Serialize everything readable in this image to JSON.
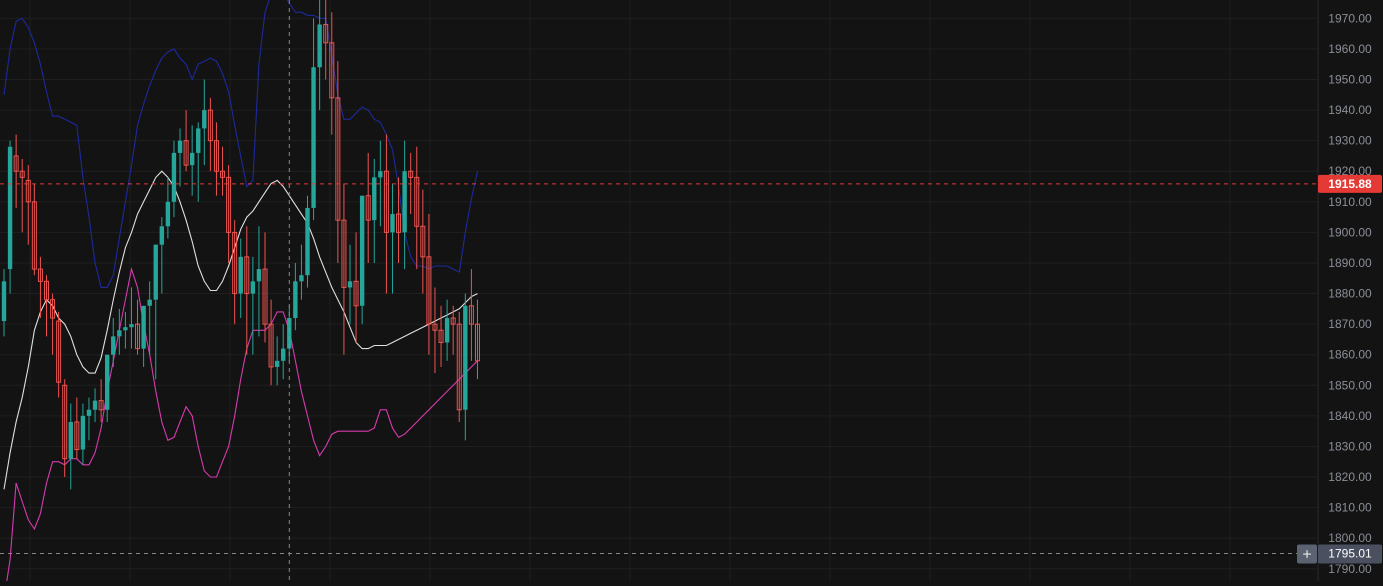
{
  "chart_data": {
    "type": "candlestick",
    "title": "",
    "xlabel": "",
    "ylabel": "",
    "ylim": [
      1786,
      1976
    ],
    "y_ticks": [
      "1970.00",
      "1960.00",
      "1950.00",
      "1940.00",
      "1930.00",
      "1920.00",
      "1910.00",
      "1900.00",
      "1890.00",
      "1880.00",
      "1870.00",
      "1860.00",
      "1850.00",
      "1840.00",
      "1830.00",
      "1820.00",
      "1810.00",
      "1800.00",
      "1790.00"
    ],
    "grid": true,
    "price_tag": {
      "value": "1915.88",
      "color": "#e53935"
    },
    "crosshair_tag": {
      "value": "1795.01",
      "color": "#4a5060"
    },
    "overlays": [
      {
        "name": "",
        "color": "#1c2a9c",
        "values": [
          1945,
          1960,
          1969,
          1970,
          1967,
          1962,
          1955,
          1946,
          1938,
          1938,
          1937,
          1936,
          1935,
          1918,
          1905,
          1890,
          1882,
          1882,
          1886,
          1898,
          1910,
          1922,
          1935,
          1942,
          1948,
          1953,
          1957,
          1959,
          1960,
          1957,
          1955,
          1950,
          1955,
          1956,
          1957,
          1956,
          1952,
          1946,
          1935,
          1925,
          1915,
          1917,
          1955,
          1972,
          1978,
          1978,
          1978,
          1975,
          1972,
          1972,
          1971,
          1971,
          1970,
          1970,
          1958,
          1945,
          1937,
          1937,
          1939,
          1941,
          1940,
          1937,
          1936,
          1932,
          1927,
          1915,
          1900,
          1892,
          1889,
          1889,
          1888,
          1889,
          1889,
          1889,
          1888,
          1887,
          1900,
          1911,
          1920
        ]
      },
      {
        "name": "",
        "color": "#e0e0e0",
        "values": [
          1816,
          1828,
          1838,
          1846,
          1856,
          1868,
          1874,
          1878,
          1876,
          1872,
          1870,
          1866,
          1860,
          1856,
          1854,
          1854,
          1859,
          1868,
          1878,
          1887,
          1895,
          1900,
          1906,
          1910,
          1914,
          1918,
          1920,
          1918,
          1915,
          1910,
          1904,
          1897,
          1889,
          1884,
          1881,
          1881,
          1884,
          1889,
          1895,
          1901,
          1905,
          1907,
          1910,
          1913,
          1916,
          1917,
          1915,
          1912,
          1909,
          1906,
          1903,
          1898,
          1892,
          1887,
          1882,
          1878,
          1874,
          1869,
          1864,
          1862,
          1862,
          1863,
          1863,
          1863,
          1864,
          1865,
          1866,
          1867,
          1868,
          1869,
          1870,
          1871,
          1872,
          1873,
          1874,
          1875,
          1877,
          1879,
          1880
        ]
      },
      {
        "name": "",
        "color": "#d63aaf",
        "values": [
          1780,
          1793,
          1818,
          1812,
          1806,
          1803,
          1808,
          1818,
          1825,
          1825,
          1824,
          1826,
          1826,
          1824,
          1824,
          1828,
          1836,
          1848,
          1858,
          1868,
          1878,
          1888,
          1882,
          1870,
          1860,
          1848,
          1838,
          1832,
          1833,
          1838,
          1843,
          1840,
          1830,
          1822,
          1820,
          1820,
          1825,
          1830,
          1840,
          1852,
          1862,
          1868,
          1868,
          1868,
          1870,
          1874,
          1874,
          1868,
          1858,
          1848,
          1840,
          1832,
          1827,
          1830,
          1834,
          1835,
          1835,
          1835,
          1835,
          1835,
          1835,
          1836,
          1842,
          1842,
          1836,
          1833,
          1834,
          1836,
          1838,
          1840,
          1842,
          1844,
          1846,
          1848,
          1850,
          1852,
          1854,
          1856,
          1858
        ]
      }
    ],
    "candles": [
      [
        1871,
        1888,
        1866,
        1884
      ],
      [
        1888,
        1930,
        1880,
        1928
      ],
      [
        1925,
        1932,
        1908,
        1920
      ],
      [
        1920,
        1924,
        1900,
        1918
      ],
      [
        1917,
        1922,
        1896,
        1910
      ],
      [
        1910,
        1916,
        1886,
        1888
      ],
      [
        1888,
        1892,
        1872,
        1884
      ],
      [
        1884,
        1886,
        1866,
        1878
      ],
      [
        1878,
        1880,
        1860,
        1872
      ],
      [
        1871,
        1874,
        1846,
        1851
      ],
      [
        1850,
        1852,
        1820,
        1826
      ],
      [
        1826,
        1844,
        1816,
        1838
      ],
      [
        1838,
        1846,
        1826,
        1829
      ],
      [
        1829,
        1844,
        1824,
        1840
      ],
      [
        1840,
        1846,
        1832,
        1842
      ],
      [
        1842,
        1849,
        1838,
        1845
      ],
      [
        1845,
        1852,
        1838,
        1842
      ],
      [
        1842,
        1856,
        1838,
        1860
      ],
      [
        1860,
        1872,
        1856,
        1866
      ],
      [
        1866,
        1875,
        1860,
        1868
      ],
      [
        1868,
        1874,
        1862,
        1869
      ],
      [
        1869,
        1882,
        1862,
        1870
      ],
      [
        1870,
        1878,
        1860,
        1862
      ],
      [
        1862,
        1872,
        1856,
        1876
      ],
      [
        1876,
        1884,
        1860,
        1878
      ],
      [
        1878,
        1892,
        1852,
        1896
      ],
      [
        1896,
        1905,
        1880,
        1902
      ],
      [
        1902,
        1918,
        1898,
        1910
      ],
      [
        1910,
        1930,
        1905,
        1926
      ],
      [
        1926,
        1934,
        1915,
        1930
      ],
      [
        1930,
        1940,
        1920,
        1922
      ],
      [
        1922,
        1935,
        1912,
        1926
      ],
      [
        1926,
        1936,
        1910,
        1934
      ],
      [
        1934,
        1950,
        1922,
        1940
      ],
      [
        1940,
        1944,
        1920,
        1930
      ],
      [
        1930,
        1936,
        1912,
        1920
      ],
      [
        1920,
        1928,
        1912,
        1918
      ],
      [
        1918,
        1922,
        1890,
        1900
      ],
      [
        1900,
        1904,
        1870,
        1880
      ],
      [
        1880,
        1898,
        1872,
        1892
      ],
      [
        1892,
        1902,
        1860,
        1880
      ],
      [
        1880,
        1892,
        1860,
        1884
      ],
      [
        1884,
        1902,
        1866,
        1888
      ],
      [
        1888,
        1900,
        1864,
        1870
      ],
      [
        1870,
        1878,
        1850,
        1856
      ],
      [
        1856,
        1866,
        1850,
        1858
      ],
      [
        1858,
        1870,
        1852,
        1862
      ],
      [
        1862,
        1876,
        1858,
        1872
      ],
      [
        1872,
        1890,
        1868,
        1884
      ],
      [
        1884,
        1896,
        1878,
        1886
      ],
      [
        1886,
        1912,
        1882,
        1908
      ],
      [
        1908,
        1970,
        1904,
        1954
      ],
      [
        1954,
        1976,
        1940,
        1968
      ],
      [
        1968,
        1978,
        1950,
        1962
      ],
      [
        1962,
        1972,
        1932,
        1944
      ],
      [
        1944,
        1956,
        1890,
        1904
      ],
      [
        1904,
        1916,
        1860,
        1882
      ],
      [
        1882,
        1896,
        1870,
        1884
      ],
      [
        1884,
        1900,
        1864,
        1876
      ],
      [
        1876,
        1912,
        1870,
        1912
      ],
      [
        1912,
        1926,
        1890,
        1904
      ],
      [
        1904,
        1924,
        1890,
        1918
      ],
      [
        1918,
        1930,
        1902,
        1920
      ],
      [
        1920,
        1932,
        1880,
        1900
      ],
      [
        1900,
        1916,
        1880,
        1906
      ],
      [
        1906,
        1918,
        1890,
        1900
      ],
      [
        1900,
        1930,
        1888,
        1920
      ],
      [
        1920,
        1926,
        1906,
        1918
      ],
      [
        1918,
        1928,
        1888,
        1902
      ],
      [
        1902,
        1914,
        1880,
        1892
      ],
      [
        1892,
        1906,
        1860,
        1870
      ],
      [
        1870,
        1882,
        1854,
        1868
      ],
      [
        1868,
        1876,
        1856,
        1864
      ],
      [
        1864,
        1878,
        1858,
        1872
      ],
      [
        1872,
        1876,
        1860,
        1870
      ],
      [
        1870,
        1874,
        1838,
        1842
      ],
      [
        1842,
        1880,
        1832,
        1876
      ],
      [
        1876,
        1888,
        1858,
        1870
      ],
      [
        1870,
        1878,
        1852,
        1858
      ]
    ]
  }
}
